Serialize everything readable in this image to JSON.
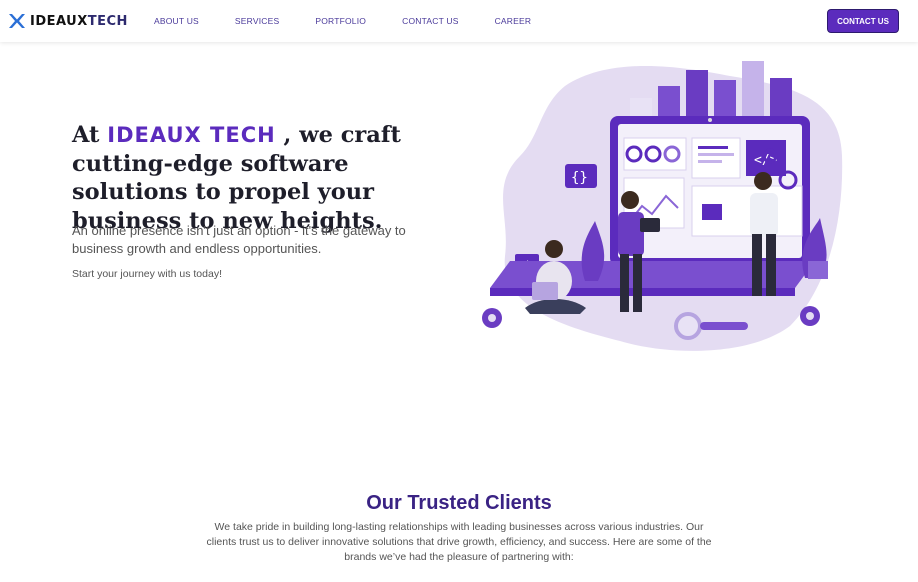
{
  "brand": {
    "logo_text_a": "IDEAUX",
    "logo_text_b": "TECH"
  },
  "nav": {
    "items": [
      "ABOUT US",
      "SERVICES",
      "PORTFOLIO",
      "CONTACT US",
      "CAREER"
    ],
    "cta_label": "CONTACT US"
  },
  "hero": {
    "title_prefix": "At ",
    "title_brand": "IDEAUX TECH",
    "title_suffix": " , we craft cutting-edge software solutions to propel your business to new heights.",
    "subtitle": "An online presence isn't just an option - it's the gateway to business growth and endless opportunities.",
    "cta_text": "Start your journey with us today!"
  },
  "clients": {
    "title": "Our Trusted Clients",
    "description": "We take pride in building long-lasting relationships with leading businesses across various industries. Our clients trust us to deliver innovative solutions that drive growth, efficiency, and success. Here are some of the brands we’ve had the pleasure of partnering with:"
  },
  "colors": {
    "primary": "#5b2bbd",
    "dark_purple": "#3a2384",
    "light_purple": "#e4dcf2"
  }
}
